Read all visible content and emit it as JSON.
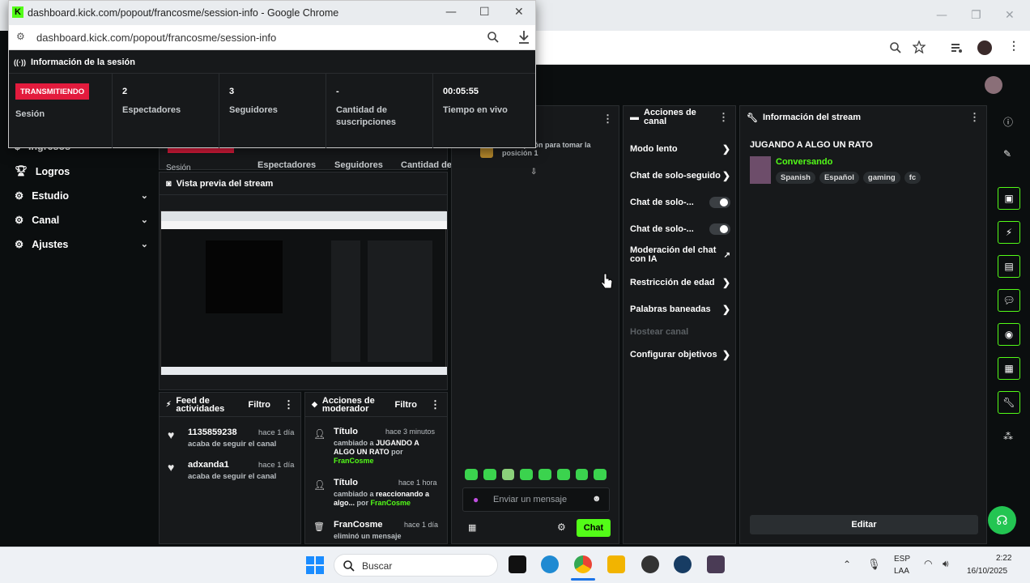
{
  "back_window": {
    "controls": [
      "—",
      "❐",
      "✕"
    ]
  },
  "popout": {
    "window_title": "dashboard.kick.com/popout/francosme/session-info - Google Chrome",
    "url": "dashboard.kick.com/popout/francosme/session-info",
    "header": "Información de la sesión",
    "live_badge": "TRANSMITIENDO",
    "session_label": "Sesión",
    "stats": [
      {
        "value": "2",
        "label": "Espectadores"
      },
      {
        "value": "3",
        "label": "Seguidores"
      },
      {
        "value": "-",
        "label": "Cantidad de suscripciones"
      },
      {
        "value": "00:05:55",
        "label": "Tiempo en vivo"
      }
    ]
  },
  "sidebar": {
    "items": [
      {
        "label": "Ingresos",
        "icon": "dollar-icon"
      },
      {
        "label": "Logros",
        "icon": "trophy-icon"
      },
      {
        "label": "Estudio",
        "icon": "gear-icon"
      },
      {
        "label": "Canal",
        "icon": "gear-icon"
      },
      {
        "label": "Ajustes",
        "icon": "gear-icon"
      }
    ]
  },
  "session_behind": {
    "labels": [
      "Sesión",
      "Espectadores",
      "Seguidores",
      "Cantidad de"
    ]
  },
  "preview": {
    "title": "Vista previa del stream"
  },
  "activity": {
    "title": "Feed de actividades",
    "filter": "Filtro",
    "items": [
      {
        "user": "1135859238",
        "time": "hace 1 día",
        "desc": "acaba de seguir el canal"
      },
      {
        "user": "adxanda1",
        "time": "hace 1 día",
        "desc": "acaba de seguir el canal"
      }
    ]
  },
  "mod": {
    "title": "Acciones de moderador",
    "filter": "Filtro",
    "items": [
      {
        "title": "Título",
        "time": "hace 3 minutos",
        "l1": "cambiado a ",
        "b1": "JUGANDO A ALGO UN RATO",
        "l2": " por ",
        "by": "FranCosme"
      },
      {
        "title": "Título",
        "time": "hace 1 hora",
        "l1": "cambiado a ",
        "b1": "reaccionando a algo...",
        "l2": " por ",
        "by": "FranCosme"
      },
      {
        "title": "FranCosme",
        "time": "hace 1 día",
        "l1": "eliminó un mensaje",
        "b1": "",
        "l2": "",
        "by": ""
      }
    ]
  },
  "chat": {
    "sub_text": "suscripción para tomar la posición 1",
    "placeholder": "Enviar un mensaje",
    "send": "Chat"
  },
  "actions": {
    "title": "Acciones de canal",
    "rows": [
      {
        "label": "Modo lento",
        "kind": "chevron"
      },
      {
        "label": "Chat de solo-seguido",
        "kind": "chevron"
      },
      {
        "label": "Chat de solo-...",
        "kind": "toggle"
      },
      {
        "label": "Chat de solo-...",
        "kind": "toggle"
      },
      {
        "label": "Moderación del chat con IA",
        "kind": "external"
      },
      {
        "label": "Restricción de edad",
        "kind": "chevron"
      },
      {
        "label": "Palabras baneadas",
        "kind": "chevron"
      },
      {
        "label": "Hostear canal",
        "kind": "disabled"
      },
      {
        "label": "Configurar objetivos",
        "kind": "chevron"
      }
    ]
  },
  "stream_info": {
    "title": "Información del stream",
    "stream_title": "JUGANDO A ALGO UN RATO",
    "category": "Conversando",
    "tags": [
      "Spanish",
      "Español",
      "gaming",
      "fc"
    ],
    "edit": "Editar"
  },
  "taskbar": {
    "search": "Buscar",
    "lang1": "ESP",
    "lang2": "LAA",
    "time": "2:22",
    "date": "16/10/2025"
  },
  "colors": {
    "accent": "#53fc18",
    "live": "#e31b3d",
    "bg": "#0b0e0f",
    "panel": "#17191b"
  }
}
